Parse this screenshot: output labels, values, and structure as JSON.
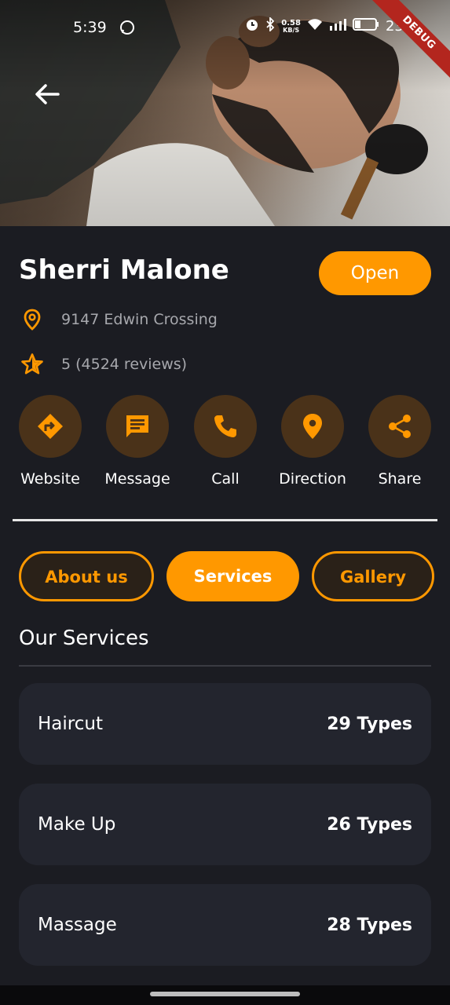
{
  "status_bar": {
    "time": "5:39",
    "net_speed_value": "0.58",
    "net_speed_unit": "KB/S",
    "battery": "23%"
  },
  "debug_banner": "DEBUG",
  "shop": {
    "name": "Sherri Malone",
    "status": "Open",
    "address": "9147 Edwin Crossing",
    "rating": "5 (4524 reviews)"
  },
  "actions": [
    {
      "label": "Website",
      "icon": "directions-sign-icon"
    },
    {
      "label": "Message",
      "icon": "message-icon"
    },
    {
      "label": "Call",
      "icon": "phone-icon"
    },
    {
      "label": "Direction",
      "icon": "location-pin-icon"
    },
    {
      "label": "Share",
      "icon": "share-icon"
    }
  ],
  "tabs": [
    {
      "label": "About us",
      "active": false
    },
    {
      "label": "Services",
      "active": true
    },
    {
      "label": "Gallery",
      "active": false
    }
  ],
  "services": {
    "title": "Our Services",
    "items": [
      {
        "name": "Haircut",
        "count": "29 Types"
      },
      {
        "name": "Make Up",
        "count": "26 Types"
      },
      {
        "name": "Massage",
        "count": "28 Types"
      }
    ]
  },
  "colors": {
    "accent": "#ff9800",
    "background": "#1b1c22",
    "card": "#23252e",
    "action_circle": "#4a3219"
  }
}
